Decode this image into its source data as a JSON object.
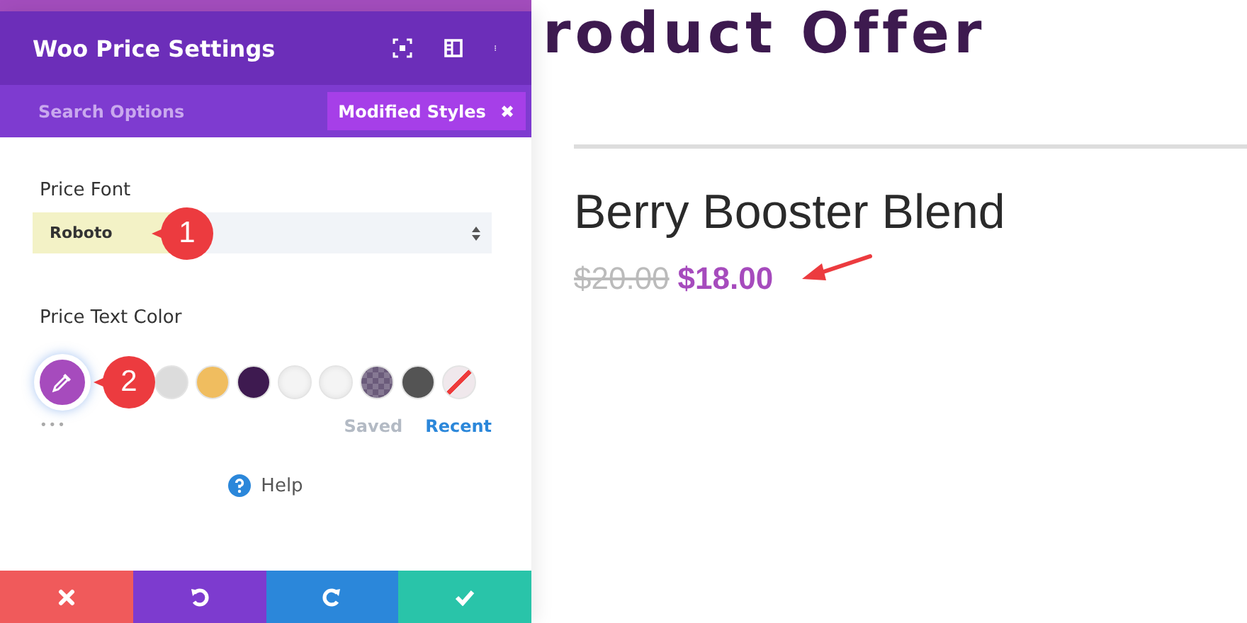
{
  "panel": {
    "title": "Woo Price Settings",
    "search": {
      "placeholder": "Search Options"
    },
    "filter": {
      "label": "Modified Styles",
      "close": "✖"
    },
    "price_font": {
      "label": "Price Font",
      "value": "Roboto",
      "callout": "1"
    },
    "price_text_color": {
      "label": "Price Text Color",
      "callout": "2",
      "swatches": [
        {
          "kind": "picker",
          "color": "#a64bbd"
        },
        {
          "kind": "solid",
          "color": "#dcdcdc"
        },
        {
          "kind": "solid",
          "color": "#f0bd5f"
        },
        {
          "kind": "solid",
          "color": "#3e1a50"
        },
        {
          "kind": "transparent",
          "color": "#f4f4f4"
        },
        {
          "kind": "transparent",
          "color": "#f4f4f4"
        },
        {
          "kind": "checker",
          "color": "#6b5b7b"
        },
        {
          "kind": "solid",
          "color": "#545454"
        },
        {
          "kind": "none",
          "color": "#f0e8ec"
        }
      ],
      "more": "•••",
      "tabs": [
        {
          "label": "Saved",
          "selected": false
        },
        {
          "label": "Recent",
          "selected": true
        }
      ]
    },
    "help": "Help",
    "actions": [
      {
        "kind": "cancel"
      },
      {
        "kind": "undo"
      },
      {
        "kind": "redo"
      },
      {
        "kind": "save"
      }
    ]
  },
  "page": {
    "heading": "roduct Offer",
    "product": {
      "name": "Berry Booster Blend",
      "old_price": "$20.00",
      "price": "$18.00"
    }
  }
}
